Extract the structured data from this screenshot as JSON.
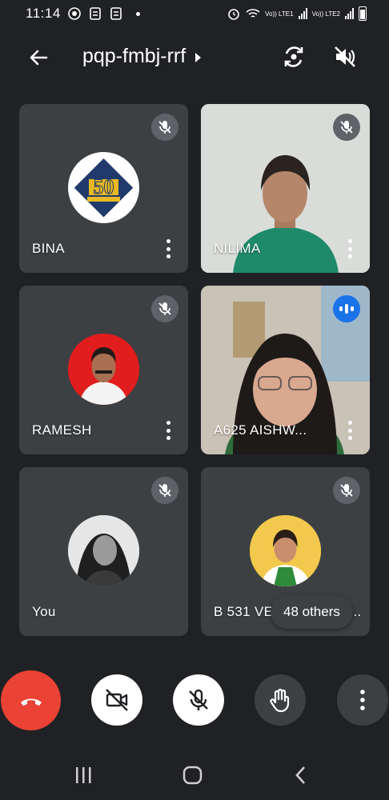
{
  "status_bar": {
    "time": "11:14",
    "sim1_label": "Vo)) LTE1",
    "sim2_label": "Vo)) LTE2"
  },
  "header": {
    "meeting_code": "pqp-fmbj-rrf"
  },
  "participants": [
    {
      "name": "BINA",
      "mic": "muted",
      "view": "avatar",
      "avatar_text": "50",
      "avatar_bg": "#ffffff"
    },
    {
      "name": "NILIMA",
      "mic": "muted",
      "view": "video"
    },
    {
      "name": "RAMESH",
      "mic": "muted",
      "view": "avatar",
      "avatar_bg": "#e11d1d"
    },
    {
      "name": "A625 AISHW...",
      "mic": "speaking",
      "view": "video"
    },
    {
      "name": "You",
      "mic": "muted",
      "view": "avatar",
      "avatar_bg": "#e8e8e8"
    },
    {
      "name": "B 531 VEDIKA HEMA...",
      "mic": "muted",
      "view": "avatar",
      "avatar_bg": "#f2c94c"
    }
  ],
  "others_pill": "48 others",
  "controls": [
    "end-call",
    "camera-off",
    "mic-off",
    "raise-hand",
    "more-options"
  ],
  "colors": {
    "background": "#202124",
    "tile": "#3c4043",
    "end_call": "#ea4335",
    "speaking_badge": "#1a73e8"
  }
}
